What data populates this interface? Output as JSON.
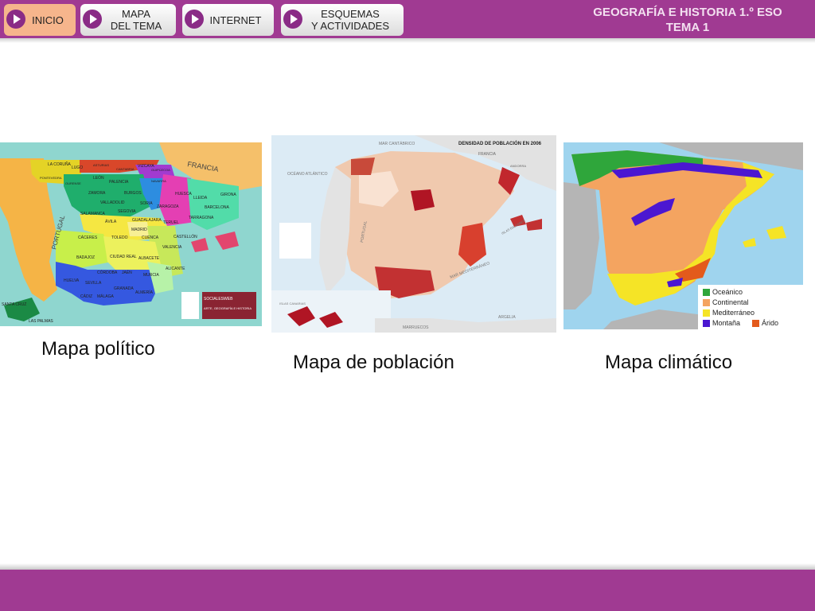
{
  "nav": {
    "inicio": "INICIO",
    "mapa_tema": "MAPA\nDEL TEMA",
    "internet": "INTERNET",
    "esquemas": "ESQUEMAS\nY ACTIVIDADES"
  },
  "header": {
    "title_line1": "GEOGRAFÍA E HISTORIA 1.º ESO",
    "title_line2": "TEMA 1"
  },
  "maps": {
    "politico": {
      "caption": "Mapa político",
      "labels": [
        "FRANCIA",
        "PORTUGAL",
        "LA CORUÑA",
        "LUGO",
        "ASTURIAS",
        "CANTABRIA",
        "VIZCAYA",
        "GUIPÚZCOA",
        "PONTEVEDRA",
        "OURENSE",
        "LEÓN",
        "PALENCIA",
        "BURGOS",
        "NAVARRA",
        "ZAMORA",
        "VALLADOLID",
        "SORIA",
        "HUESCA",
        "LLEIDA",
        "GIRONA",
        "SALAMANCA",
        "ÁVILA",
        "SEGOVIA",
        "ZARAGOZA",
        "BARCELONA",
        "TERUEL",
        "TARRAGONA",
        "GUADALAJARA",
        "MADRID",
        "CÁCERES",
        "TOLEDO",
        "CUENCA",
        "CASTELLÓN",
        "BADAJOZ",
        "CIUDAD REAL",
        "ALBACETE",
        "VALENCIA",
        "ALICANTE",
        "HUELVA",
        "CÓRDOBA",
        "JAÉN",
        "MURCIA",
        "SEVILLA",
        "GRANADA",
        "ALMERÍA",
        "CÁDIZ",
        "MÁLAGA",
        "SANTA CRUZ",
        "LAS PALMAS",
        "SOCIALESWEB",
        "ARTE, GEOGRAFÍA E HISTORIA"
      ]
    },
    "poblacion": {
      "caption": "Mapa de población",
      "title": "DENSIDAD DE POBLACIÓN EN 2006",
      "labels": [
        "FRANCIA",
        "ANDORRA",
        "MAR CANTÁBRICO",
        "OCÉANO ATLÁNTICO",
        "PORTUGAL",
        "MAR MEDITERRÁNEO",
        "ISLAS BALEARES",
        "MARRUECOS",
        "ARGELIA",
        "ISLAS CANARIAS"
      ]
    },
    "climatico": {
      "caption": "Mapa climático",
      "legend": [
        {
          "label": "Oceánico",
          "color": "#2fa63b"
        },
        {
          "label": "Continental",
          "color": "#f4a460"
        },
        {
          "label": "Mediterráneo",
          "color": "#f5e426"
        },
        {
          "label": "Montaña",
          "color": "#4b17d1"
        },
        {
          "label": "Árido",
          "color": "#e35a1c"
        }
      ]
    }
  },
  "colors": {
    "brand": "#a03a92",
    "nav_active": "#f6b58c"
  }
}
